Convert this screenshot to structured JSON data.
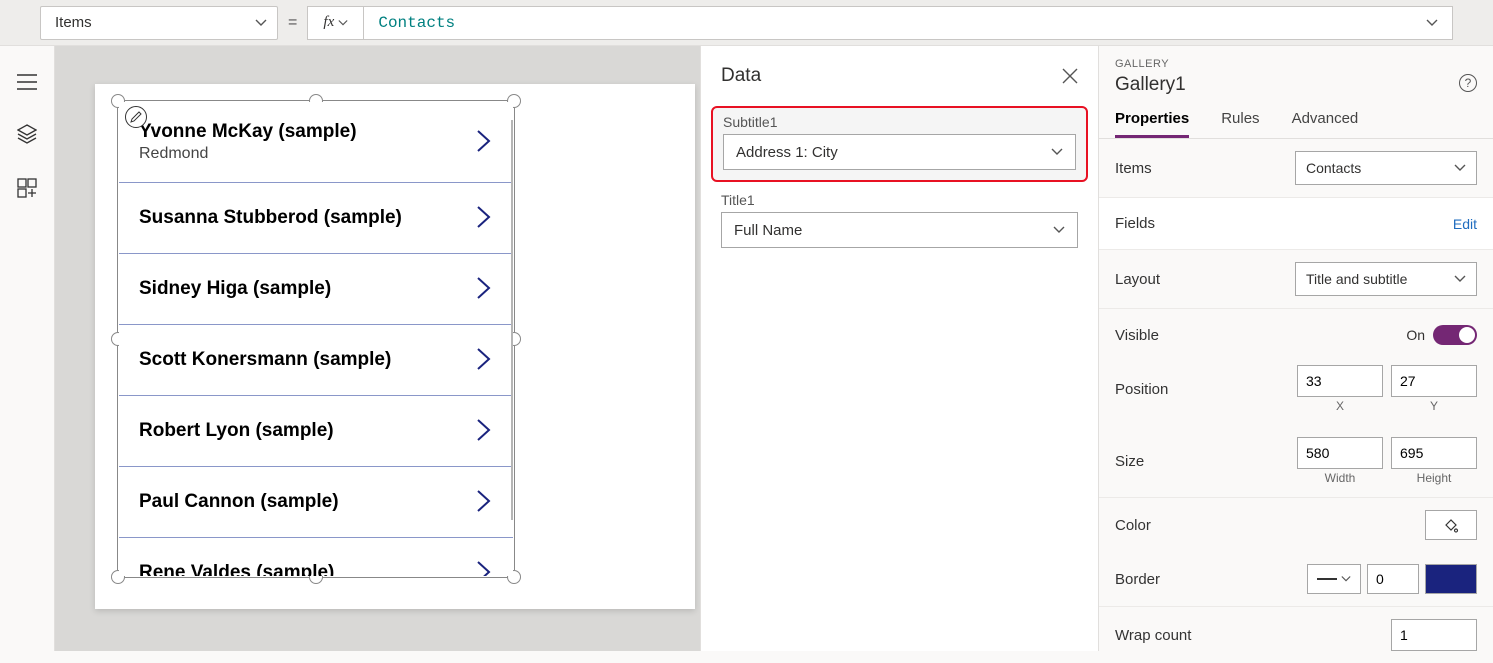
{
  "formula_bar": {
    "property": "Items",
    "fx_label": "fx",
    "expression": "Contacts"
  },
  "gallery": {
    "rows": [
      {
        "title": "Yvonne McKay (sample)",
        "subtitle": "Redmond"
      },
      {
        "title": "Susanna Stubberod (sample)",
        "subtitle": ""
      },
      {
        "title": "Sidney Higa (sample)",
        "subtitle": ""
      },
      {
        "title": "Scott Konersmann (sample)",
        "subtitle": ""
      },
      {
        "title": "Robert Lyon (sample)",
        "subtitle": ""
      },
      {
        "title": "Paul Cannon (sample)",
        "subtitle": ""
      },
      {
        "title": "Rene Valdes (sample)",
        "subtitle": ""
      }
    ]
  },
  "data_panel": {
    "title": "Data",
    "subtitle_label": "Subtitle1",
    "subtitle_value": "Address 1: City",
    "title_label": "Title1",
    "title_value": "Full Name"
  },
  "prop_panel": {
    "type_label": "GALLERY",
    "name": "Gallery1",
    "tabs": {
      "properties": "Properties",
      "rules": "Rules",
      "advanced": "Advanced"
    },
    "items_label": "Items",
    "items_value": "Contacts",
    "fields_label": "Fields",
    "fields_link": "Edit",
    "layout_label": "Layout",
    "layout_value": "Title and subtitle",
    "visible_label": "Visible",
    "visible_value": "On",
    "position_label": "Position",
    "position_x": "33",
    "position_y": "27",
    "x_label": "X",
    "y_label": "Y",
    "size_label": "Size",
    "size_w": "580",
    "size_h": "695",
    "w_label": "Width",
    "h_label": "Height",
    "color_label": "Color",
    "border_label": "Border",
    "border_width": "0",
    "wrap_label": "Wrap count",
    "wrap_value": "1"
  }
}
